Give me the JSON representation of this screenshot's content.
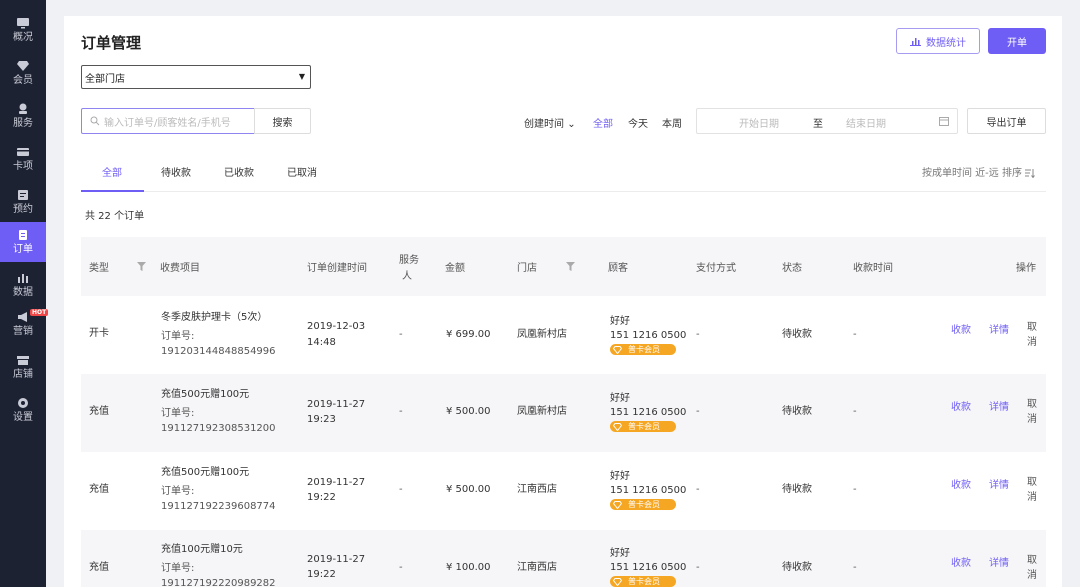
{
  "sidebar": {
    "items": [
      {
        "label": "概况",
        "icon": "monitor-icon"
      },
      {
        "label": "会员",
        "icon": "diamond-icon"
      },
      {
        "label": "服务",
        "icon": "service-icon"
      },
      {
        "label": "卡项",
        "icon": "card-icon"
      },
      {
        "label": "预约",
        "icon": "calendar-icon"
      },
      {
        "label": "订单",
        "icon": "clipboard-icon",
        "active": true
      },
      {
        "label": "数据",
        "icon": "bar-chart-icon"
      },
      {
        "label": "营销",
        "icon": "megaphone-icon",
        "badge": "HOT"
      },
      {
        "label": "店铺",
        "icon": "store-icon"
      },
      {
        "label": "设置",
        "icon": "gear-icon"
      }
    ]
  },
  "header": {
    "title": "订单管理",
    "stats_button": "数据统计",
    "open_button": "开单"
  },
  "store_select": {
    "value": "全部门店"
  },
  "search": {
    "placeholder": "输入订单号/顾客姓名/手机号",
    "button": "搜索"
  },
  "time_filter": {
    "label": "创建时间",
    "options": [
      "全部",
      "今天",
      "本周"
    ],
    "active": "全部",
    "start_placeholder": "开始日期",
    "separator": "至",
    "end_placeholder": "结束日期"
  },
  "export_button": "导出订单",
  "tabs": [
    "全部",
    "待收款",
    "已收款",
    "已取消"
  ],
  "sort_label": "按成单时间 近-远 排序",
  "order_count": "共 22 个订单",
  "table": {
    "headers": {
      "type": "类型",
      "item": "收费项目",
      "created": "订单创建时间",
      "staff_1": "服务",
      "staff_2": "人",
      "amount": "金额",
      "store": "门店",
      "customer": "顾客",
      "payment": "支付方式",
      "status": "状态",
      "paid_time": "收款时间",
      "actions": "操作"
    },
    "rows": [
      {
        "type": "开卡",
        "item": "冬季皮肤护理卡（5次）",
        "order_label": "订单号:",
        "order_no": "191203144848854996",
        "date": "2019-12-03",
        "time": "14:48",
        "staff": "-",
        "amount": "¥ 699.00",
        "store": "凤凰新村店",
        "customer_name": "好好",
        "phone": "151 1216 0500",
        "badge": "普卡会员",
        "payment": "-",
        "status": "待收款",
        "paid_time": "-"
      },
      {
        "type": "充值",
        "item": "充值500元赠100元",
        "order_label": "订单号:",
        "order_no": "191127192308531200",
        "date": "2019-11-27",
        "time": "19:23",
        "staff": "-",
        "amount": "¥ 500.00",
        "store": "凤凰新村店",
        "customer_name": "好好",
        "phone": "151 1216 0500",
        "badge": "普卡会员",
        "payment": "-",
        "status": "待收款",
        "paid_time": "-"
      },
      {
        "type": "充值",
        "item": "充值500元赠100元",
        "order_label": "订单号:",
        "order_no": "191127192239608774",
        "date": "2019-11-27",
        "time": "19:22",
        "staff": "-",
        "amount": "¥ 500.00",
        "store": "江南西店",
        "customer_name": "好好",
        "phone": "151 1216 0500",
        "badge": "普卡会员",
        "payment": "-",
        "status": "待收款",
        "paid_time": "-"
      },
      {
        "type": "充值",
        "item": "充值100元赠10元",
        "order_label": "订单号:",
        "order_no": "191127192220989282",
        "date": "2019-11-27",
        "time": "19:22",
        "staff": "-",
        "amount": "¥ 100.00",
        "store": "江南西店",
        "customer_name": "好好",
        "phone": "151 1216 0500",
        "badge": "普卡会员",
        "payment": "-",
        "status": "待收款",
        "paid_time": "-"
      }
    ],
    "actions": {
      "collect": "收款",
      "detail": "详情",
      "cancel": "取消"
    }
  },
  "colors": {
    "accent": "#6f5ef5",
    "sidebar_bg": "#1d2233",
    "badge": "#f5a623",
    "hot": "#f04848"
  }
}
